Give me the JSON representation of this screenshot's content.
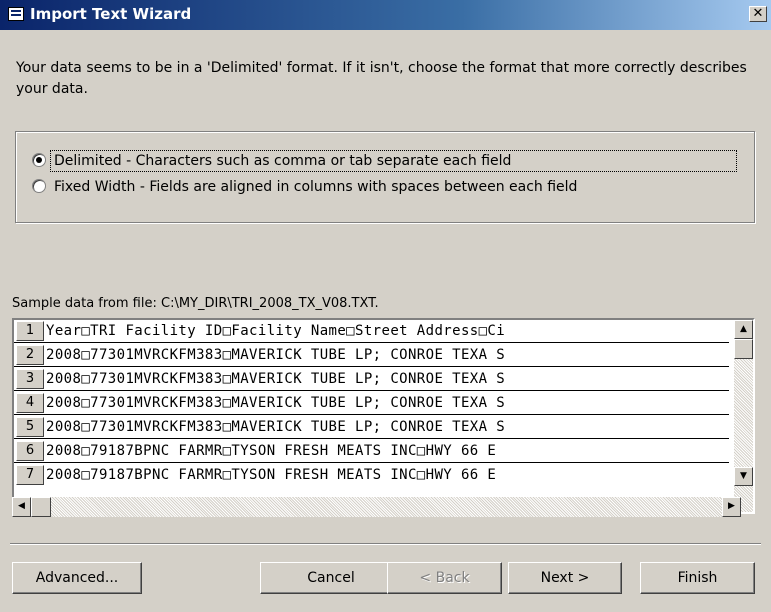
{
  "window": {
    "title": "Import Text Wizard",
    "close_glyph": "✕"
  },
  "intro_text": "Your data seems to be in a 'Delimited' format. If it isn't, choose the format that more correctly describes your data.",
  "format_options": [
    {
      "label": "Delimited - Characters such as comma or tab separate each field",
      "checked": true
    },
    {
      "label": "Fixed Width - Fields are aligned in columns with spaces between each field",
      "checked": false
    }
  ],
  "sample": {
    "label": "Sample data from file: C:\\MY_DIR\\TRI_2008_TX_V08.TXT.",
    "rows": [
      {
        "num": "1",
        "text": "Year□TRI Facility ID□Facility Name□Street Address□Ci"
      },
      {
        "num": "2",
        "text": "2008□77301MVRCKFM383□MAVERICK TUBE LP; CONROE TEXA S"
      },
      {
        "num": "3",
        "text": "2008□77301MVRCKFM383□MAVERICK TUBE LP; CONROE TEXA S"
      },
      {
        "num": "4",
        "text": "2008□77301MVRCKFM383□MAVERICK TUBE LP; CONROE TEXA S"
      },
      {
        "num": "5",
        "text": "2008□77301MVRCKFM383□MAVERICK TUBE LP; CONROE TEXA S"
      },
      {
        "num": "6",
        "text": "2008□79187BPNC FARMR□TYSON FRESH MEATS INC□HWY 66 E"
      },
      {
        "num": "7",
        "text": "2008□79187BPNC FARMR□TYSON FRESH MEATS INC□HWY 66 E"
      }
    ]
  },
  "scroll_glyphs": {
    "up": "▲",
    "down": "▼",
    "left": "◀",
    "right": "▶"
  },
  "buttons": {
    "advanced": "Advanced...",
    "cancel": "Cancel",
    "back": "< Back",
    "next": "Next >",
    "finish": "Finish"
  }
}
